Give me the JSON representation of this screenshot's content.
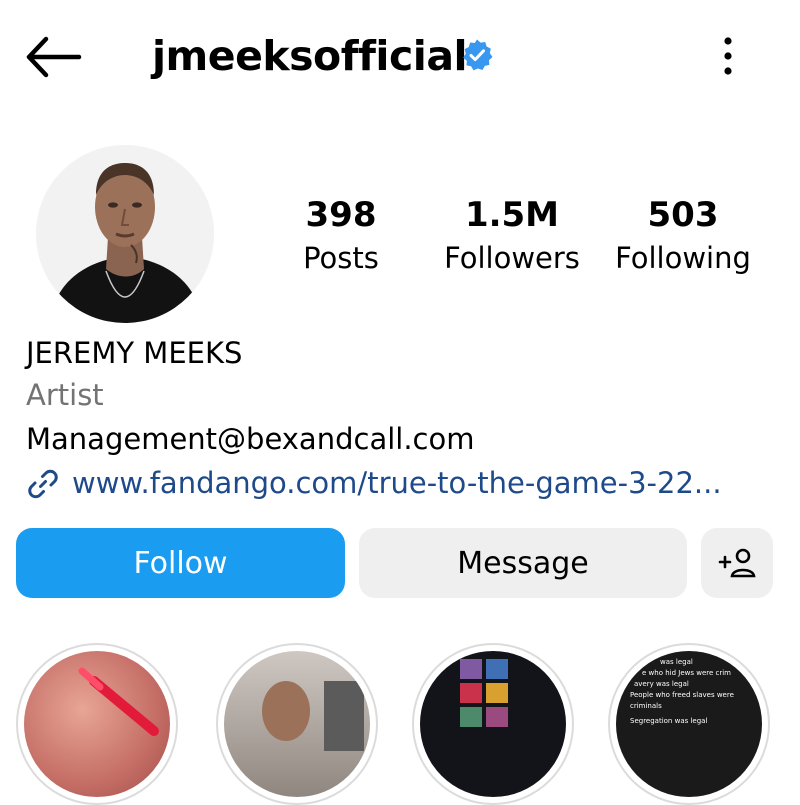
{
  "header": {
    "username": "jmeeksofficial",
    "back_icon": "arrow-left-icon",
    "verified_icon": "verified-badge-icon",
    "more_icon": "more-vertical-icon"
  },
  "stats": [
    {
      "value": "398",
      "label": "Posts"
    },
    {
      "value": "1.5M",
      "label": "Followers"
    },
    {
      "value": "503",
      "label": "Following"
    }
  ],
  "profile": {
    "name": "JEREMY MEEKS",
    "category": "Artist",
    "email": "Management@bexandcall.com",
    "link": "www.fandango.com/true-to-the-game-3-22...",
    "link_icon": "link-icon"
  },
  "actions": {
    "follow_label": "Follow",
    "message_label": "Message",
    "add_user_icon": "add-user-icon"
  },
  "highlights": {
    "item4_lines": [
      "was legal",
      "e who hid Jews were crim",
      "avery was legal",
      "People who freed slaves were",
      "criminals",
      "Segregation was legal"
    ]
  },
  "colors": {
    "accent_blue": "#1a9df0",
    "verified_blue": "#3897f0",
    "link_blue": "#1f4a8a",
    "secondary_text": "#737373",
    "button_grey": "#efefef"
  }
}
